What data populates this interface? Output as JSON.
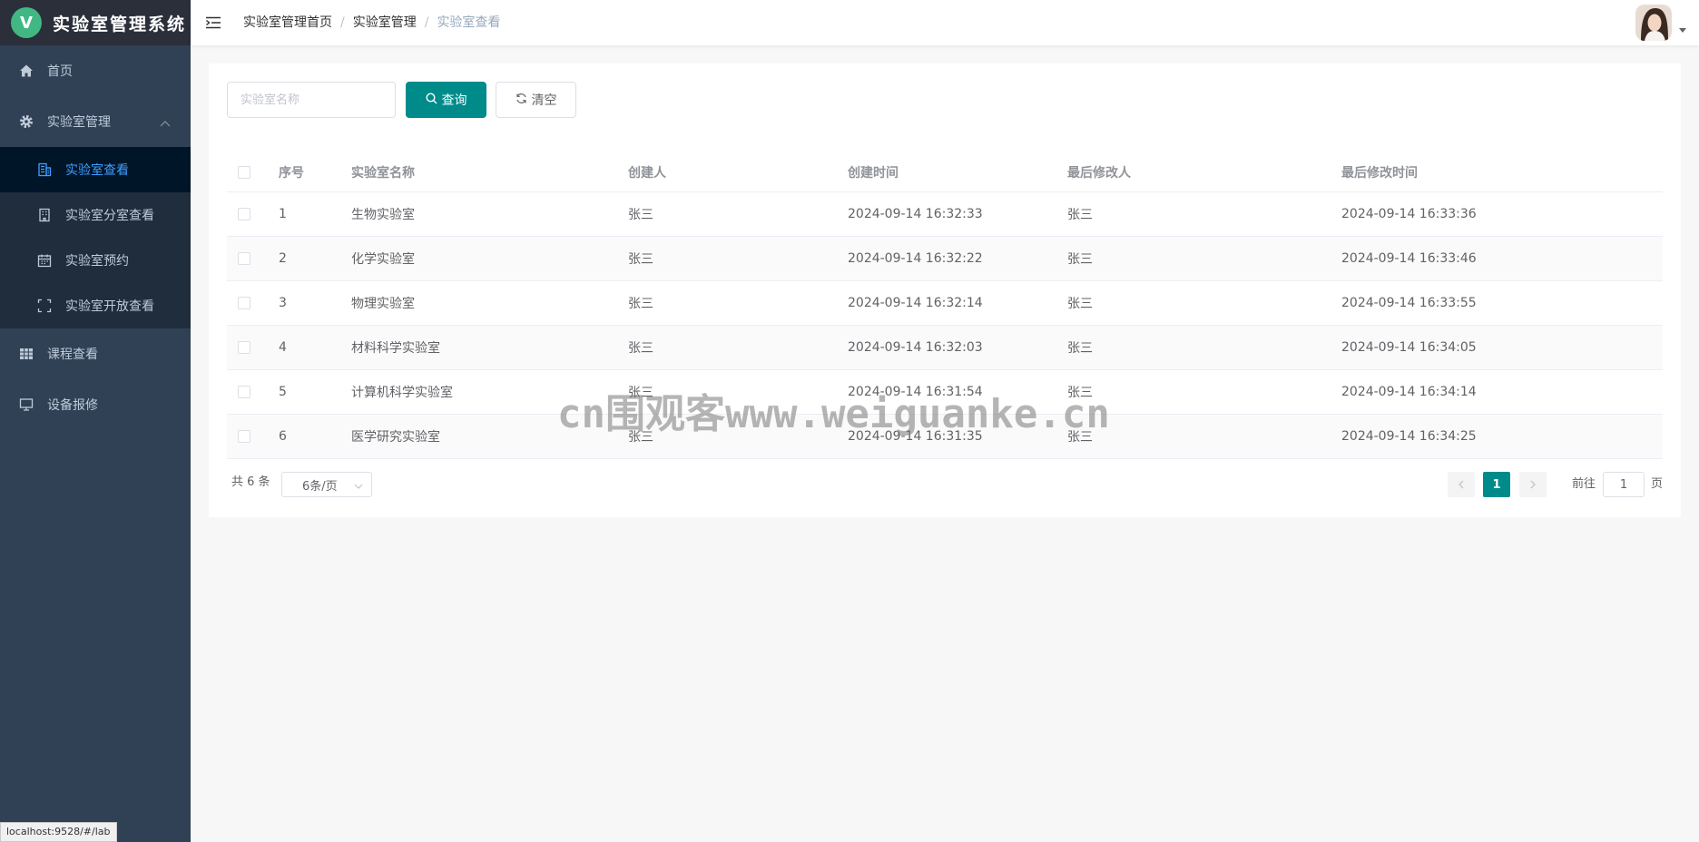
{
  "app": {
    "logo_letter": "V",
    "title": "实验室管理系统"
  },
  "sidebar": {
    "items": [
      {
        "label": "首页",
        "icon": "home-icon"
      },
      {
        "label": "实验室管理",
        "icon": "gear-icon",
        "expanded": true,
        "children": [
          {
            "label": "实验室查看",
            "icon": "building-icon",
            "active": true
          },
          {
            "label": "实验室分室查看",
            "icon": "office-icon"
          },
          {
            "label": "实验室预约",
            "icon": "calendar-icon"
          },
          {
            "label": "实验室开放查看",
            "icon": "fullscreen-icon"
          }
        ]
      },
      {
        "label": "课程查看",
        "icon": "grid-icon"
      },
      {
        "label": "设备报修",
        "icon": "monitor-icon"
      }
    ]
  },
  "header": {
    "breadcrumb": [
      "实验室管理首页",
      "实验室管理",
      "实验室查看"
    ],
    "separator": "/"
  },
  "search": {
    "placeholder": "实验室名称",
    "value": ""
  },
  "buttons": {
    "query": "查询",
    "clear": "清空"
  },
  "table": {
    "columns": [
      "序号",
      "实验室名称",
      "创建人",
      "创建时间",
      "最后修改人",
      "最后修改时间"
    ],
    "rows": [
      [
        "1",
        "生物实验室",
        "张三",
        "2024-09-14 16:32:33",
        "张三",
        "2024-09-14 16:33:36"
      ],
      [
        "2",
        "化学实验室",
        "张三",
        "2024-09-14 16:32:22",
        "张三",
        "2024-09-14 16:33:46"
      ],
      [
        "3",
        "物理实验室",
        "张三",
        "2024-09-14 16:32:14",
        "张三",
        "2024-09-14 16:33:55"
      ],
      [
        "4",
        "材料科学实验室",
        "张三",
        "2024-09-14 16:32:03",
        "张三",
        "2024-09-14 16:34:05"
      ],
      [
        "5",
        "计算机科学实验室",
        "张三",
        "2024-09-14 16:31:54",
        "张三",
        "2024-09-14 16:34:14"
      ],
      [
        "6",
        "医学研究实验室",
        "张三",
        "2024-09-14 16:31:35",
        "张三",
        "2024-09-14 16:34:25"
      ]
    ]
  },
  "pagination": {
    "total": "共 6 条",
    "page_size": "6条/页",
    "current_page": "1",
    "jump_label": "前往",
    "jump_value": "1",
    "jump_unit": "页"
  },
  "watermark": "cn围观客www.weiguanke.cn",
  "status_url": "localhost:9528/#/lab",
  "colors": {
    "sidebar_bg": "#304156",
    "active_text": "#409eff",
    "primary": "#008b8b"
  }
}
